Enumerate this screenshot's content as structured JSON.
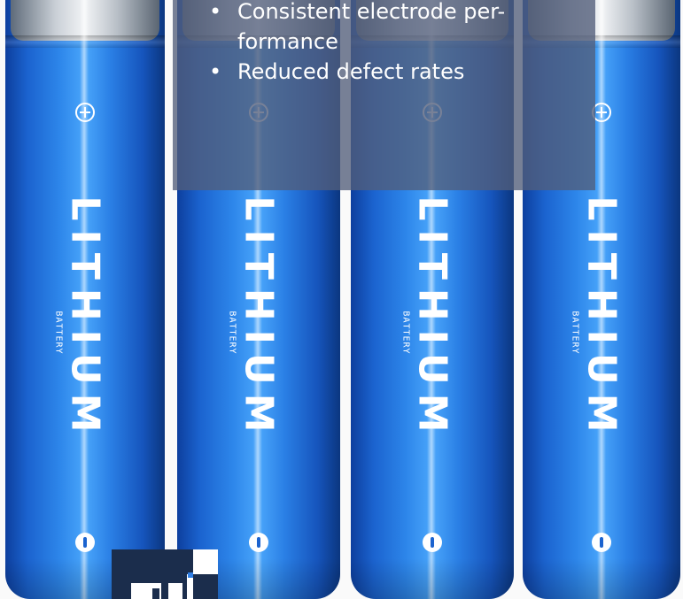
{
  "image": {
    "subject": "four blue cylindrical lithium battery cells with a translucent text overlay",
    "colors": {
      "battery_blue": "#2d86ea",
      "overlay": "#525e7a",
      "text": "#ffffff",
      "logo_navy": "#1b2d4c"
    }
  },
  "batteries": [
    {
      "brand": "LITHIUM",
      "sub": "BATTERY"
    },
    {
      "brand": "LITHIUM",
      "sub": "BATTERY"
    },
    {
      "brand": "LITHIUM",
      "sub": "BATTERY"
    },
    {
      "brand": "LITHIUM",
      "sub": "BATTERY"
    }
  ],
  "overlay": {
    "bullets": [
      "Consistent electrode per-formance",
      "Reduced defect rates"
    ]
  },
  "logo": {
    "name": "logo-mark"
  }
}
